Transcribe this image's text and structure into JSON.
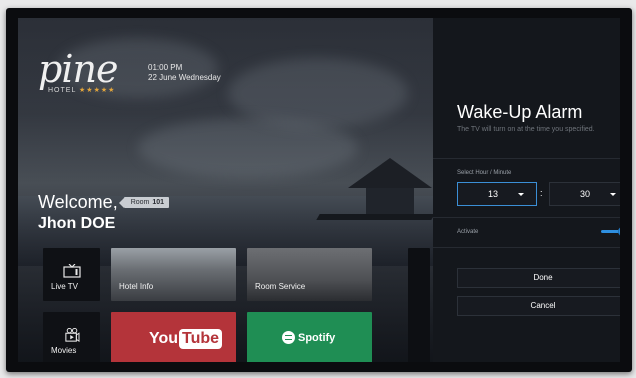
{
  "brand": {
    "logo_text": "pine",
    "subtitle": "HOTEL",
    "stars": "★★★★★"
  },
  "clock": {
    "time": "01:00 PM",
    "date": "22 June Wednesday"
  },
  "welcome": {
    "greeting": "Welcome,",
    "room_label": "Room",
    "room_number": "101",
    "guest_name": "Jhon DOE"
  },
  "tiles": {
    "live_tv": "Live TV",
    "hotel_info": "Hotel Info",
    "room_service": "Room Service",
    "movies": "Movies",
    "youtube_left": "You",
    "youtube_right": "Tube",
    "spotify": "Spotify"
  },
  "alarm_panel": {
    "title": "Wake-Up Alarm",
    "subtitle": "The TV will turn on at the time you specified.",
    "select_label": "Select Hour / Minute",
    "hour": "13",
    "separator": ":",
    "minute": "30",
    "activate_label": "Activate",
    "activate_state": true,
    "done_label": "Done",
    "cancel_label": "Cancel"
  },
  "colors": {
    "accent": "#2e8fe0",
    "panel_bg": "#14171c",
    "youtube": "#b4343a",
    "spotify": "#1f8e54"
  }
}
